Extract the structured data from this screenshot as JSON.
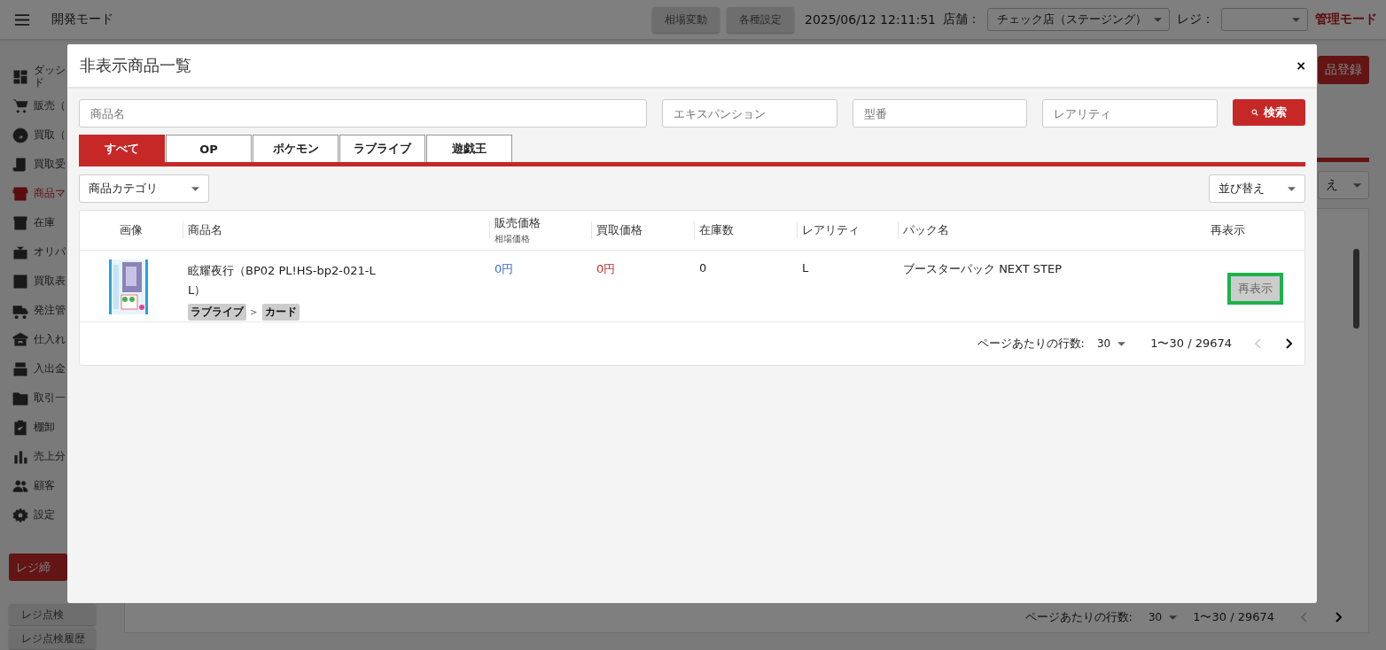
{
  "topbar": {
    "title": "開発モード",
    "buttons": [
      "相場変動",
      "各種設定"
    ],
    "datetime": "2025/06/12 12:11:51",
    "store_label": "店舗：",
    "store_value": "チェック店（ステージング）",
    "register_label": "レジ：",
    "mode": "管理モード"
  },
  "sidebar": {
    "items": [
      {
        "lines": [
          "ダッシ",
          "ド"
        ],
        "selected": false
      },
      {
        "lines": [
          "販売（"
        ],
        "selected": false
      },
      {
        "lines": [
          "買取（"
        ],
        "selected": false
      },
      {
        "lines": [
          "買取受"
        ],
        "selected": false
      },
      {
        "lines": [
          "商品マ"
        ],
        "selected": true
      },
      {
        "lines": [
          "在庫"
        ],
        "selected": false
      },
      {
        "lines": [
          "オリパ"
        ],
        "selected": false
      },
      {
        "lines": [
          "買取表"
        ],
        "selected": false
      },
      {
        "lines": [
          "発注管"
        ],
        "selected": false
      },
      {
        "lines": [
          "仕入れ"
        ],
        "selected": false
      },
      {
        "lines": [
          "入出金"
        ],
        "selected": false
      },
      {
        "lines": [
          "取引一"
        ],
        "selected": false
      },
      {
        "lines": [
          "棚卸"
        ],
        "selected": false
      },
      {
        "lines": [
          "売上分"
        ],
        "selected": false
      },
      {
        "lines": [
          "顧客"
        ],
        "selected": false
      },
      {
        "lines": [
          "設定"
        ],
        "selected": false
      }
    ],
    "buttons": [
      {
        "label": "レジ締",
        "kind": "primary"
      },
      {
        "label": "レジ点検",
        "kind": "secondary"
      },
      {
        "label": "レジ点検履歴",
        "kind": "secondary"
      }
    ]
  },
  "page": {
    "register_button": "品登録",
    "sort_partial": "え",
    "rows_label": "ページあたりの行数:",
    "rows_value": "30",
    "range": "1〜30 / 29674"
  },
  "modal": {
    "title": "非表示商品一覧",
    "close": "×",
    "filters": [
      {
        "placeholder": "商品名"
      },
      {
        "placeholder": "エキスパンション"
      },
      {
        "placeholder": "型番"
      },
      {
        "placeholder": "レアリティ"
      }
    ],
    "search_button": "検索",
    "tabs": [
      {
        "label": "すべて",
        "selected": true
      },
      {
        "label": "OP",
        "selected": false
      },
      {
        "label": "ポケモン",
        "selected": false
      },
      {
        "label": "ラブライブ",
        "selected": false
      },
      {
        "label": "遊戯王",
        "selected": false
      }
    ],
    "category_select": "商品カテゴリ",
    "sort_select": "並び替え",
    "table": {
      "columns": [
        {
          "label": "画像"
        },
        {
          "label": "商品名"
        },
        {
          "label": "販売価格",
          "sub": "相場価格"
        },
        {
          "label": "買取価格"
        },
        {
          "label": "在庫数"
        },
        {
          "label": "レアリティ"
        },
        {
          "label": "パック名"
        },
        {
          "label": "再表示"
        }
      ],
      "rows": [
        {
          "image": {
            "kind": "picture"
          },
          "name": "眩耀夜行（BP02 PL!HS-bp2-021-L L）",
          "tags": [
            "ラブライブ",
            "カード"
          ],
          "tag_separator": ">",
          "sell_price": "0円",
          "buy_price": "0円",
          "stock": "0",
          "rarity": "L",
          "pack": "ブースターパック NEXT STEP",
          "action": "再表示",
          "highlighted": true
        }
      ]
    },
    "pagination": {
      "rows_label": "ページあたりの行数:",
      "rows_value": "30",
      "range": "1〜30 / 29674",
      "prev_disabled": true,
      "next_disabled": false
    }
  }
}
